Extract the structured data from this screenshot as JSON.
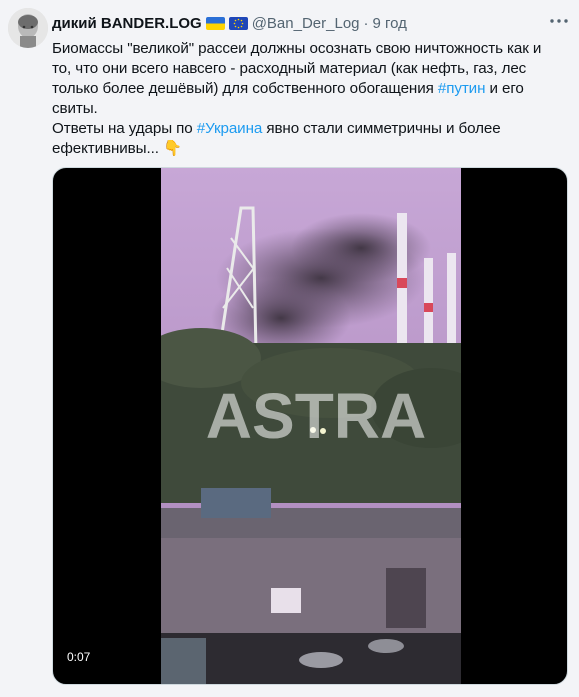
{
  "tweet": {
    "author_name": "дикий BANDER.LOG",
    "handle": "@Ban_Der_Log",
    "separator": "·",
    "time": "9 год",
    "text": {
      "line1": "Биомассы \"великой\" рассеи должны осознать свою ничтожность как и",
      "line2": "то, что они всего навсего - расходный материал (как нефть, газ, лес",
      "line3_before": "только более дешёвый) для собственного обогащения ",
      "hashtag1": "#путин",
      "line3_after": " и его",
      "line4": "свиты.",
      "line5_before": "Ответы на удары по ",
      "hashtag2": "#Украина",
      "line5_after": " явно стали симметричны и более",
      "line6": "ефективнивы... ",
      "emoji": "👇"
    },
    "media": {
      "watermark": "ASTRA",
      "duration": "0:07"
    }
  },
  "colors": {
    "background": "#f3f4f7",
    "hashtag": "#1d9bf0",
    "secondary_text": "#536471"
  },
  "icons": {
    "flags": [
      "ukraine-flag-icon",
      "eu-flag-icon"
    ],
    "more": "more-options-icon"
  }
}
